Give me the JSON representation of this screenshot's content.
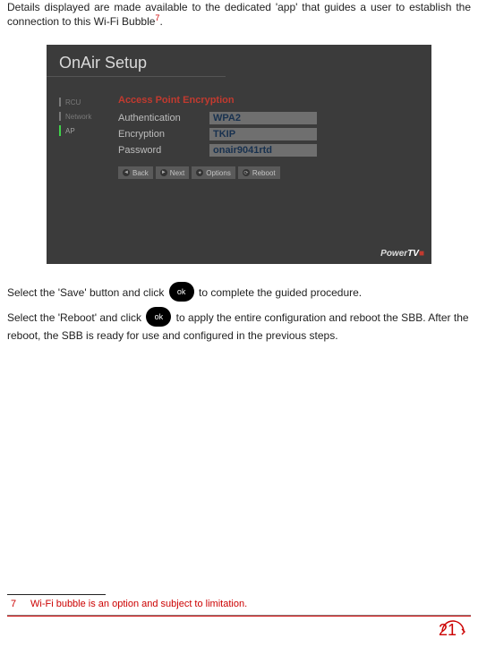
{
  "intro": {
    "text_a": "Details displayed are made available to the dedicated 'app' that guides a user to establish the connection to this Wi-Fi Bubble",
    "ref": "7",
    "text_b": "."
  },
  "shot": {
    "title": "OnAir Setup",
    "side": [
      {
        "label": "RCU",
        "active": false
      },
      {
        "label": "Network",
        "active": false
      },
      {
        "label": "AP",
        "active": true
      }
    ],
    "section": "Access Point Encryption",
    "rows": [
      {
        "label": "Authentication",
        "value": "WPA2"
      },
      {
        "label": "Encryption",
        "value": "TKIP"
      },
      {
        "label": "Password",
        "value": "onair9041rtd"
      }
    ],
    "buttons": [
      {
        "glyph": "◄",
        "label": "Back"
      },
      {
        "glyph": "►",
        "label": "Next"
      },
      {
        "glyph": "✦",
        "label": "Options"
      },
      {
        "glyph": "⟳",
        "label": "Reboot"
      }
    ],
    "logo_a": "Power",
    "logo_b": "TV",
    "logo_c": "■"
  },
  "line1": {
    "a": "Select the 'Save' button and click ",
    "ok": "ok",
    "b": " to complete the guided procedure."
  },
  "line2": {
    "a": "Select the 'Reboot' and click ",
    "ok": "ok",
    "b": " to apply the entire configuration and reboot the SBB. After the reboot, the SBB is ready for use and configured in the previous steps."
  },
  "footnote": {
    "num": "7",
    "text": "Wi-Fi bubble is an option and subject to limitation."
  },
  "page_number": "21"
}
